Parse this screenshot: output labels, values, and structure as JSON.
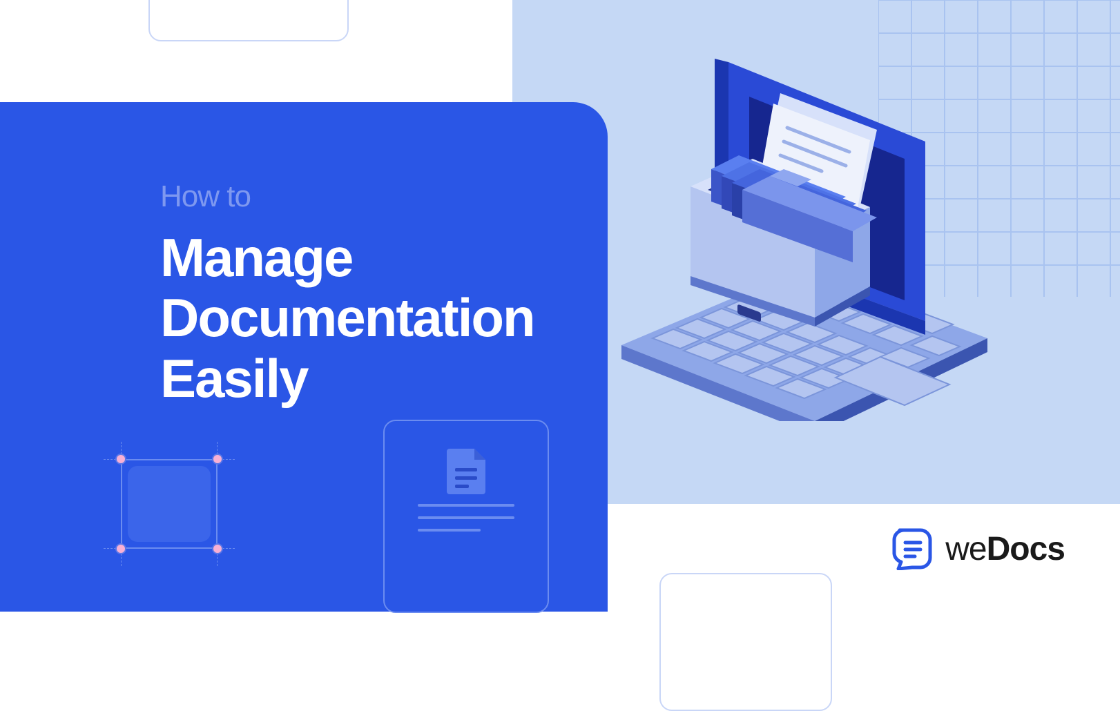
{
  "hero": {
    "subtitle": "How to",
    "title_line1": "Manage",
    "title_line2": "Documentation",
    "title_line3": "Easily"
  },
  "brand": {
    "prefix": "we",
    "suffix": "Docs"
  },
  "colors": {
    "primary": "#2a56e6",
    "light_bg": "#c5d8f5",
    "accent_pink": "#f8b0d4"
  }
}
